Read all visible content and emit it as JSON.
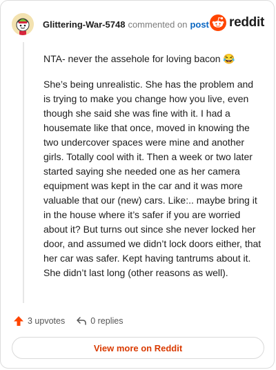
{
  "header": {
    "author": "Glittering-War-5748",
    "commented_text": "commented on",
    "post_link": "post",
    "brand_name": "reddit",
    "brand_color": "#ff4500"
  },
  "comment": {
    "paragraph_1": "NTA- never the assehole for loving bacon 😂",
    "paragraph_2": "She’s being unrealistic. She has the problem and is trying to make you change how you live, even though she said she was fine with it. I had a housemate like that once, moved in knowing the two undercover spaces were mine and another girls. Totally cool with it. Then a week or two later started saying she needed one as her camera equipment was kept in the car and it was more valuable that our (new) cars. Like:.. maybe bring it in the house where it’s safer if you are worried about it? But turns out since she never locked her door, and assumed we didn’t lock doors either, that her car was safer. Kept having tantrums about it. She didn’t last long (other reasons as well)."
  },
  "actions": {
    "upvotes": "3 upvotes",
    "replies": "0 replies",
    "upvote_icon": "arrow-up-icon",
    "reply_icon": "reply-icon"
  },
  "footer": {
    "view_more": "View more on Reddit"
  }
}
